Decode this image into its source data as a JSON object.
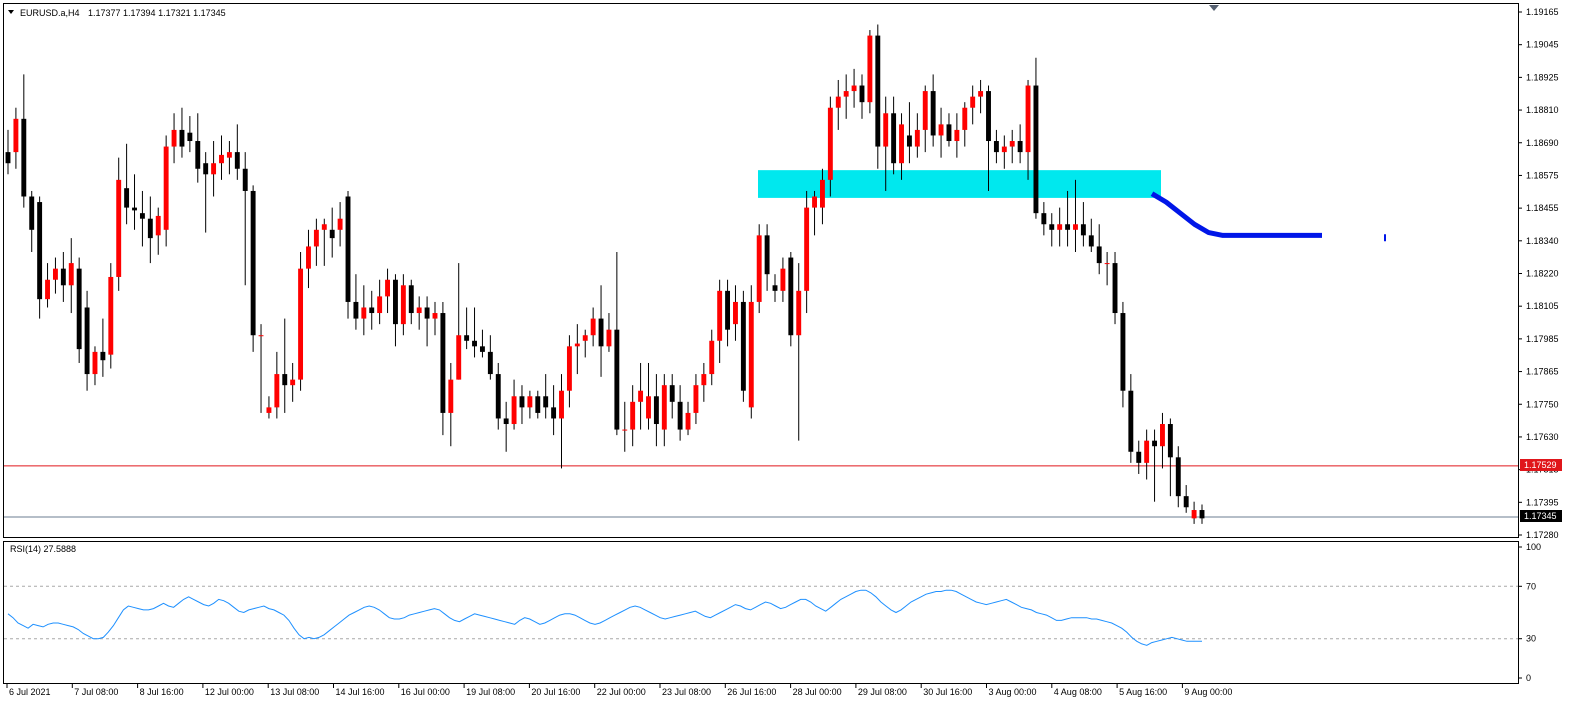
{
  "colors": {
    "bull": "#ff0000",
    "bear": "#000000",
    "wick": "#000000",
    "zone": "#00e8ee",
    "ma_line": "#0016e8",
    "bid_line": "#e0161b",
    "ask_line": "#6b7c92",
    "rsi_line": "#1e90ff",
    "grid_dash": "#a8a8a8",
    "doji_green": "#22c022"
  },
  "main_header": {
    "symbol": "EURUSD.a,H4",
    "ohlc": "1.17377 1.17394 1.17321 1.17345"
  },
  "rsi_header": {
    "label": "RSI(14) 27.5888"
  },
  "price_axis": {
    "ticks": [
      "1.19165",
      "1.19045",
      "1.18925",
      "1.18810",
      "1.18690",
      "1.18575",
      "1.18455",
      "1.18340",
      "1.18220",
      "1.18105",
      "1.17985",
      "1.17865",
      "1.17750",
      "1.17630",
      "1.17515",
      "1.17395",
      "1.17280"
    ],
    "bid_label": "1.17529",
    "last_label": "1.17345"
  },
  "rsi_axis": {
    "ticks": [
      "100",
      "70",
      "30",
      "0"
    ]
  },
  "time_axis": {
    "labels": [
      "6 Jul 2021",
      "7 Jul 08:00",
      "8 Jul 16:00",
      "12 Jul 00:00",
      "13 Jul 08:00",
      "14 Jul 16:00",
      "16 Jul 00:00",
      "19 Jul 08:00",
      "20 Jul 16:00",
      "22 Jul 00:00",
      "23 Jul 08:00",
      "26 Jul 16:00",
      "28 Jul 00:00",
      "29 Jul 08:00",
      "30 Jul 16:00",
      "3 Aug 00:00",
      "4 Aug 08:00",
      "5 Aug 16:00",
      "9 Aug 00:00"
    ]
  },
  "chart_data": [
    {
      "type": "candlestick",
      "title": "EURUSD.a,H4",
      "timeframe": "H4",
      "ylim": [
        1.1728,
        1.1917
      ],
      "ohlc": [
        [
          1.1866,
          1.1874,
          1.1858,
          1.1862
        ],
        [
          1.1866,
          1.1882,
          1.186,
          1.1878
        ],
        [
          1.1878,
          1.1894,
          1.1846,
          1.185
        ],
        [
          1.185,
          1.1852,
          1.183,
          1.1838
        ],
        [
          1.1848,
          1.185,
          1.1806,
          1.1813
        ],
        [
          1.1813,
          1.1826,
          1.181,
          1.182
        ],
        [
          1.182,
          1.1828,
          1.1815,
          1.1824
        ],
        [
          1.1824,
          1.183,
          1.1812,
          1.1818
        ],
        [
          1.1818,
          1.1835,
          1.1808,
          1.1826
        ],
        [
          1.1824,
          1.1828,
          1.179,
          1.1795
        ],
        [
          1.181,
          1.1816,
          1.178,
          1.1786
        ],
        [
          1.1786,
          1.1796,
          1.1782,
          1.1794
        ],
        [
          1.1794,
          1.1806,
          1.1785,
          1.1791
        ],
        [
          1.1793,
          1.1826,
          1.1788,
          1.1821
        ],
        [
          1.1821,
          1.1864,
          1.1816,
          1.1856
        ],
        [
          1.1853,
          1.1869,
          1.184,
          1.1846
        ],
        [
          1.1846,
          1.1858,
          1.1838,
          1.1845
        ],
        [
          1.1844,
          1.1852,
          1.1832,
          1.1842
        ],
        [
          1.1842,
          1.185,
          1.1826,
          1.1835
        ],
        [
          1.1836,
          1.1846,
          1.1829,
          1.1843
        ],
        [
          1.1838,
          1.1872,
          1.1832,
          1.1868
        ],
        [
          1.1868,
          1.188,
          1.1862,
          1.1874
        ],
        [
          1.1874,
          1.1882,
          1.1864,
          1.1868
        ],
        [
          1.1873,
          1.1879,
          1.1866,
          1.187
        ],
        [
          1.187,
          1.188,
          1.1855,
          1.186
        ],
        [
          1.1862,
          1.1866,
          1.1837,
          1.1858
        ],
        [
          1.1858,
          1.187,
          1.185,
          1.1862
        ],
        [
          1.1862,
          1.1872,
          1.1856,
          1.1865
        ],
        [
          1.1864,
          1.187,
          1.1858,
          1.1866
        ],
        [
          1.1866,
          1.1876,
          1.1856,
          1.186
        ],
        [
          1.186,
          1.1866,
          1.1818,
          1.1852
        ],
        [
          1.1852,
          1.1854,
          1.1794,
          1.18
        ],
        [
          1.18,
          1.1804,
          1.1772,
          1.18
        ],
        [
          1.1772,
          1.1778,
          1.177,
          1.1774
        ],
        [
          1.1774,
          1.1794,
          1.177,
          1.1786
        ],
        [
          1.1786,
          1.1806,
          1.1772,
          1.1782
        ],
        [
          1.1782,
          1.179,
          1.1776,
          1.1784
        ],
        [
          1.1784,
          1.183,
          1.178,
          1.1824
        ],
        [
          1.1824,
          1.1838,
          1.1817,
          1.1832
        ],
        [
          1.1832,
          1.1842,
          1.1825,
          1.1838
        ],
        [
          1.1838,
          1.1842,
          1.1825,
          1.184
        ],
        [
          1.1838,
          1.1846,
          1.1828,
          1.1835
        ],
        [
          1.1838,
          1.1848,
          1.1832,
          1.1842
        ],
        [
          1.185,
          1.1852,
          1.1806,
          1.1812
        ],
        [
          1.1812,
          1.1822,
          1.1802,
          1.1806
        ],
        [
          1.1806,
          1.1818,
          1.18,
          1.181
        ],
        [
          1.181,
          1.1816,
          1.1802,
          1.1808
        ],
        [
          1.1808,
          1.182,
          1.1804,
          1.1814
        ],
        [
          1.1814,
          1.1824,
          1.1808,
          1.182
        ],
        [
          1.182,
          1.1822,
          1.1796,
          1.1804
        ],
        [
          1.1804,
          1.1822,
          1.18,
          1.1818
        ],
        [
          1.1818,
          1.182,
          1.1804,
          1.1808
        ],
        [
          1.1808,
          1.1814,
          1.1802,
          1.181
        ],
        [
          1.181,
          1.1814,
          1.1796,
          1.1806
        ],
        [
          1.1806,
          1.1812,
          1.18,
          1.1808
        ],
        [
          1.1808,
          1.1812,
          1.1764,
          1.1772
        ],
        [
          1.1772,
          1.179,
          1.176,
          1.1784
        ],
        [
          1.1784,
          1.1826,
          1.1784,
          1.18
        ],
        [
          1.18,
          1.181,
          1.1795,
          1.1798
        ],
        [
          1.1798,
          1.181,
          1.1792,
          1.1796
        ],
        [
          1.1796,
          1.1802,
          1.1792,
          1.1794
        ],
        [
          1.1794,
          1.18,
          1.1784,
          1.1786
        ],
        [
          1.1786,
          1.179,
          1.1766,
          1.177
        ],
        [
          1.177,
          1.1776,
          1.1758,
          1.1768
        ],
        [
          1.1768,
          1.1784,
          1.1766,
          1.1778
        ],
        [
          1.1778,
          1.1782,
          1.1768,
          1.1774
        ],
        [
          1.1774,
          1.178,
          1.177,
          1.1778
        ],
        [
          1.1778,
          1.178,
          1.177,
          1.1772
        ],
        [
          1.1778,
          1.1786,
          1.177,
          1.1774
        ],
        [
          1.1774,
          1.1782,
          1.1764,
          1.177
        ],
        [
          1.177,
          1.1786,
          1.1752,
          1.178
        ],
        [
          1.178,
          1.18,
          1.1774,
          1.1796
        ],
        [
          1.1796,
          1.1804,
          1.1786,
          1.1797
        ],
        [
          1.1798,
          1.1802,
          1.1792,
          1.18
        ],
        [
          1.18,
          1.181,
          1.1796,
          1.1806
        ],
        [
          1.1806,
          1.1818,
          1.1785,
          1.1796
        ],
        [
          1.1796,
          1.1808,
          1.1794,
          1.1802
        ],
        [
          1.1802,
          1.183,
          1.1764,
          1.1766
        ],
        [
          1.1766,
          1.1776,
          1.1758,
          1.1766
        ],
        [
          1.1766,
          1.1782,
          1.176,
          1.1776
        ],
        [
          1.1776,
          1.179,
          1.1766,
          1.178
        ],
        [
          1.177,
          1.179,
          1.1766,
          1.1778
        ],
        [
          1.1778,
          1.1786,
          1.176,
          1.1768
        ],
        [
          1.1766,
          1.1786,
          1.176,
          1.1782
        ],
        [
          1.1782,
          1.1786,
          1.177,
          1.1776
        ],
        [
          1.1776,
          1.1782,
          1.1762,
          1.1766
        ],
        [
          1.1766,
          1.1776,
          1.1764,
          1.1772
        ],
        [
          1.1772,
          1.1786,
          1.1768,
          1.1782
        ],
        [
          1.1782,
          1.179,
          1.1776,
          1.1786
        ],
        [
          1.1786,
          1.1802,
          1.1782,
          1.1798
        ],
        [
          1.1798,
          1.182,
          1.179,
          1.1816
        ],
        [
          1.1816,
          1.182,
          1.1796,
          1.1802
        ],
        [
          1.1804,
          1.1818,
          1.1798,
          1.1812
        ],
        [
          1.1812,
          1.1816,
          1.1776,
          1.178
        ],
        [
          1.1774,
          1.1818,
          1.177,
          1.1812
        ],
        [
          1.1812,
          1.184,
          1.1808,
          1.1836
        ],
        [
          1.1836,
          1.184,
          1.1816,
          1.1822
        ],
        [
          1.1818,
          1.1822,
          1.1812,
          1.1816
        ],
        [
          1.1816,
          1.1828,
          1.1812,
          1.1824
        ],
        [
          1.1828,
          1.183,
          1.1796,
          1.18
        ],
        [
          1.18,
          1.1826,
          1.1762,
          1.1816
        ],
        [
          1.1816,
          1.1852,
          1.1808,
          1.1846
        ],
        [
          1.1846,
          1.1852,
          1.1836,
          1.185
        ],
        [
          1.1846,
          1.186,
          1.184,
          1.1856
        ],
        [
          1.1856,
          1.1886,
          1.185,
          1.1882
        ],
        [
          1.1882,
          1.1892,
          1.1874,
          1.1886
        ],
        [
          1.1886,
          1.1894,
          1.1878,
          1.1888
        ],
        [
          1.1888,
          1.1896,
          1.1882,
          1.189
        ],
        [
          1.189,
          1.1894,
          1.1878,
          1.1884
        ],
        [
          1.1884,
          1.191,
          1.188,
          1.1908
        ],
        [
          1.1908,
          1.1912,
          1.186,
          1.1868
        ],
        [
          1.1868,
          1.1886,
          1.1852,
          1.188
        ],
        [
          1.188,
          1.1886,
          1.1858,
          1.1862
        ],
        [
          1.1862,
          1.188,
          1.1856,
          1.1876
        ],
        [
          1.1872,
          1.1884,
          1.1862,
          1.1868
        ],
        [
          1.1868,
          1.188,
          1.1864,
          1.1874
        ],
        [
          1.1874,
          1.189,
          1.1866,
          1.1888
        ],
        [
          1.1888,
          1.1894,
          1.1868,
          1.1872
        ],
        [
          1.1872,
          1.1882,
          1.1864,
          1.1876
        ],
        [
          1.1876,
          1.188,
          1.1868,
          1.187
        ],
        [
          1.187,
          1.188,
          1.1864,
          1.1874
        ],
        [
          1.1874,
          1.1884,
          1.1868,
          1.1882
        ],
        [
          1.1882,
          1.189,
          1.1876,
          1.1886
        ],
        [
          1.1886,
          1.1892,
          1.188,
          1.1888
        ],
        [
          1.1888,
          1.189,
          1.1852,
          1.187
        ],
        [
          1.187,
          1.1874,
          1.1862,
          1.1866
        ],
        [
          1.1866,
          1.1872,
          1.186,
          1.1868
        ],
        [
          1.1868,
          1.1874,
          1.1862,
          1.187
        ],
        [
          1.187,
          1.1876,
          1.1862,
          1.1866
        ],
        [
          1.1866,
          1.1892,
          1.1856,
          1.189
        ],
        [
          1.189,
          1.19,
          1.1842,
          1.1844
        ],
        [
          1.1844,
          1.1848,
          1.1836,
          1.184
        ],
        [
          1.184,
          1.1844,
          1.1832,
          1.1838
        ],
        [
          1.1838,
          1.1846,
          1.1832,
          1.184
        ],
        [
          1.184,
          1.1852,
          1.1832,
          1.1838
        ],
        [
          1.1838,
          1.1856,
          1.183,
          1.184
        ],
        [
          1.184,
          1.1848,
          1.1832,
          1.1836
        ],
        [
          1.1836,
          1.1842,
          1.183,
          1.1832
        ],
        [
          1.1832,
          1.184,
          1.1822,
          1.1826
        ],
        [
          1.1826,
          1.183,
          1.1818,
          1.1826
        ],
        [
          1.1826,
          1.183,
          1.1804,
          1.1808
        ],
        [
          1.1808,
          1.1812,
          1.1774,
          1.178
        ],
        [
          1.178,
          1.1786,
          1.1754,
          1.1758
        ],
        [
          1.1758,
          1.1762,
          1.175,
          1.1754
        ],
        [
          1.1754,
          1.1766,
          1.1748,
          1.1762
        ],
        [
          1.1762,
          1.1766,
          1.174,
          1.176
        ],
        [
          1.176,
          1.1772,
          1.1752,
          1.1768
        ],
        [
          1.1768,
          1.177,
          1.1742,
          1.1756
        ],
        [
          1.1756,
          1.176,
          1.1738,
          1.1742
        ],
        [
          1.1742,
          1.1746,
          1.1736,
          1.1738
        ],
        [
          1.1734,
          1.174,
          1.1732,
          1.1737
        ],
        [
          1.1737,
          1.1739,
          1.1732,
          1.1734
        ]
      ],
      "demand_zone": {
        "y_top": 1.18595,
        "y_bottom": 1.18495
      },
      "ma_line": [
        [
          0,
          1.1851
        ],
        [
          1,
          1.1848
        ],
        [
          2,
          1.1844
        ],
        [
          3,
          1.184
        ],
        [
          4,
          1.1837
        ],
        [
          5,
          1.1836
        ],
        [
          6,
          1.1836
        ],
        [
          7,
          1.1836
        ],
        [
          8,
          1.1836
        ],
        [
          9,
          1.1836
        ],
        [
          10,
          1.1836
        ],
        [
          11,
          1.1836
        ],
        [
          12,
          1.1836
        ]
      ],
      "bid_price": 1.17529,
      "last_price": 1.17345
    },
    {
      "type": "line",
      "title": "RSI(14) 27.5888",
      "ylim": [
        0,
        100
      ],
      "levels": [
        70,
        30
      ],
      "values": [
        49,
        46,
        42,
        40,
        38,
        41,
        40,
        39,
        41,
        42,
        42,
        41,
        40,
        39,
        37,
        34,
        32,
        30,
        30,
        31,
        35,
        40,
        46,
        52,
        55,
        54,
        53,
        52,
        52,
        53,
        55,
        57,
        55,
        54,
        57,
        60,
        62,
        60,
        58,
        56,
        55,
        57,
        60,
        59,
        57,
        54,
        51,
        50,
        52,
        53,
        54,
        55,
        53,
        52,
        50,
        48,
        44,
        38,
        33,
        30,
        31,
        30,
        31,
        33,
        36,
        39,
        42,
        45,
        48,
        50,
        52,
        54,
        55,
        54,
        52,
        49,
        46,
        45,
        45,
        46,
        48,
        49,
        50,
        51,
        52,
        53,
        52,
        49,
        46,
        44,
        43,
        45,
        47,
        49,
        48,
        47,
        46,
        45,
        44,
        43,
        42,
        41,
        44,
        46,
        45,
        43,
        41,
        42,
        44,
        46,
        48,
        49,
        49,
        48,
        46,
        44,
        42,
        41,
        42,
        44,
        46,
        48,
        50,
        52,
        54,
        55,
        54,
        52,
        50,
        48,
        46,
        45,
        46,
        47,
        48,
        49,
        50,
        51,
        49,
        47,
        46,
        48,
        50,
        52,
        54,
        56,
        55,
        53,
        52,
        54,
        56,
        58,
        57,
        55,
        53,
        54,
        56,
        58,
        60,
        60,
        58,
        55,
        53,
        51,
        54,
        57,
        60,
        62,
        64,
        66,
        67,
        67,
        65,
        62,
        58,
        55,
        52,
        50,
        52,
        55,
        58,
        60,
        62,
        64,
        65,
        66,
        66,
        67,
        67,
        66,
        64,
        62,
        60,
        58,
        57,
        56,
        57,
        58,
        59,
        60,
        58,
        56,
        54,
        53,
        52,
        50,
        49,
        48,
        46,
        44,
        44,
        45,
        46,
        46,
        46,
        46,
        45,
        45,
        44,
        43,
        42,
        40,
        38,
        35,
        31,
        28,
        26,
        25,
        27,
        28,
        29,
        30,
        31,
        30,
        29,
        28,
        28,
        28,
        28
      ]
    }
  ]
}
